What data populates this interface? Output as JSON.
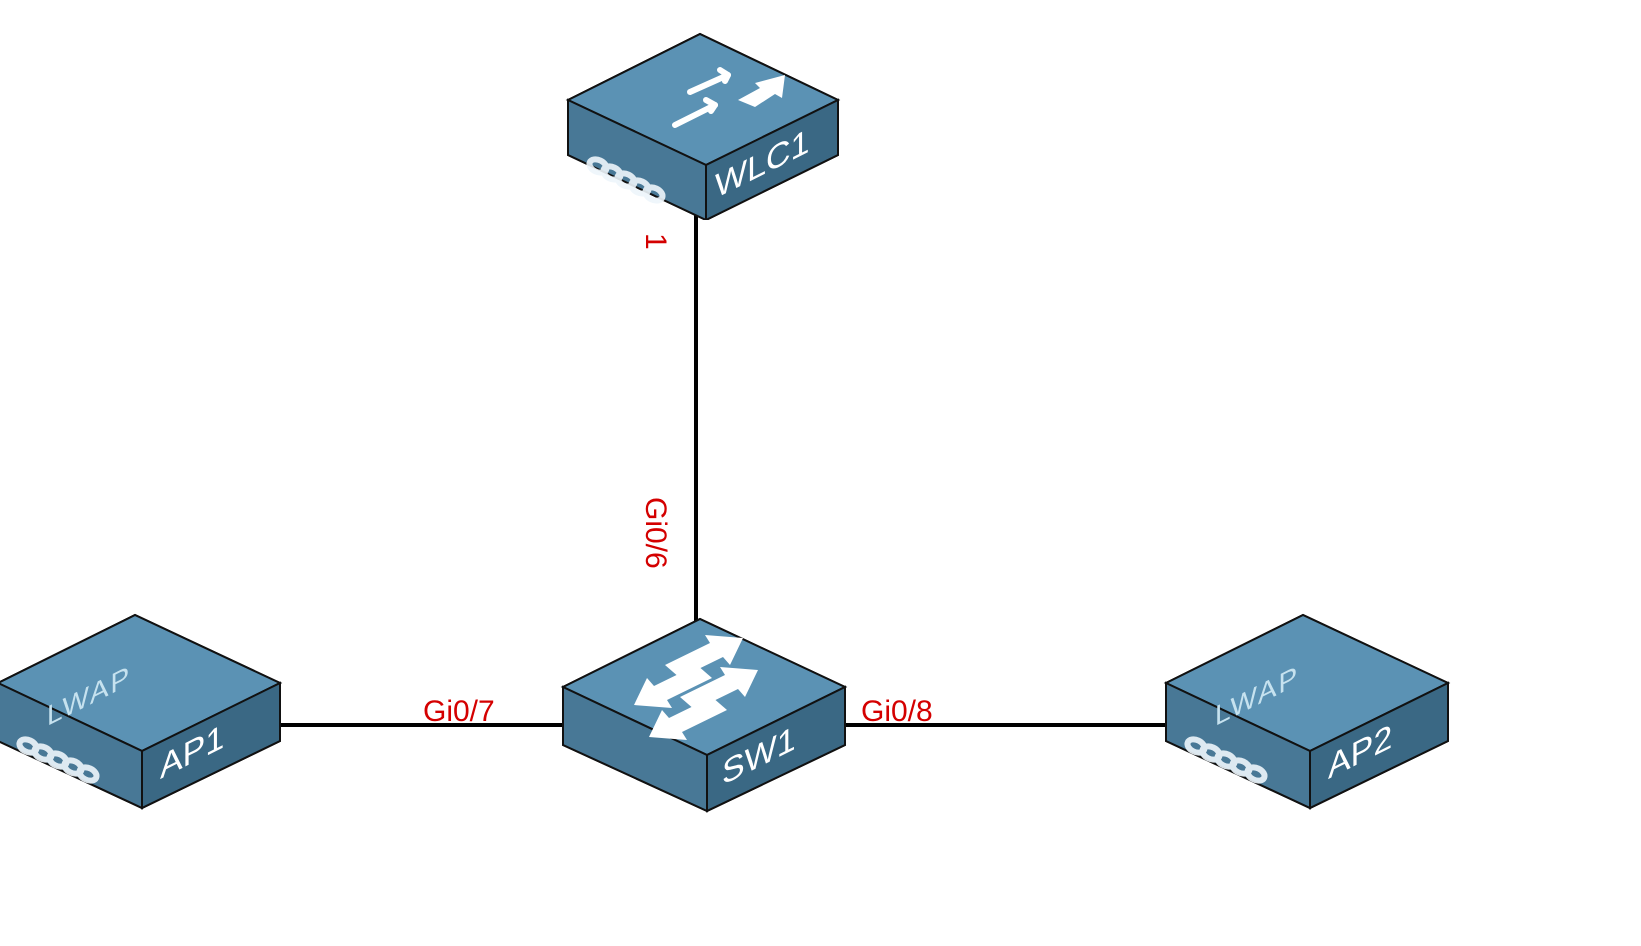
{
  "nodes": {
    "wlc": {
      "label": "WLC1"
    },
    "sw": {
      "label": "SW1"
    },
    "ap1": {
      "label": "AP1",
      "type_label": "LWAP"
    },
    "ap2": {
      "label": "AP2",
      "type_label": "LWAP"
    }
  },
  "ports": {
    "wlc_sw_top": "1",
    "wlc_sw_bottom": "Gi0/6",
    "sw_ap1": "Gi0/7",
    "sw_ap2": "Gi0/8"
  }
}
